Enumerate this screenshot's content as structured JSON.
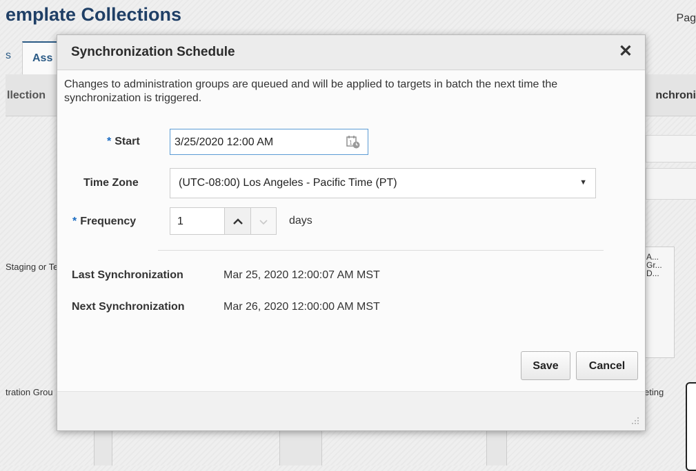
{
  "background": {
    "page_title": "emplate Collections",
    "page_link": "Pag",
    "tabs": [
      {
        "label": "s"
      },
      {
        "label": "Ass"
      }
    ],
    "section_left": "llection",
    "section_right": "nchroni",
    "node_staging": "Staging or Te",
    "node_a_lines": [
      "A...",
      "Gr...",
      "D..."
    ],
    "node_tration": "tration Grou",
    "node_eting": "eting"
  },
  "dialog": {
    "title": "Synchronization Schedule",
    "close_glyph": "✕",
    "message": "Changes to administration groups are queued and will be applied to targets in batch the next time the synchronization is triggered.",
    "required_marker": "*",
    "start": {
      "label": "Start",
      "value": "3/25/2020 12:00 AM",
      "icon": "calendar-clock-icon"
    },
    "time_zone": {
      "label": "Time Zone",
      "selected": "(UTC-08:00) Los Angeles - Pacific Time (PT)",
      "arrow_glyph": "▼"
    },
    "frequency": {
      "label": "Frequency",
      "value": "1",
      "unit": "days",
      "up_glyph": "⌃",
      "down_glyph": "⌄"
    },
    "last_sync": {
      "label": "Last Synchronization",
      "value": "Mar 25, 2020 12:00:07 AM MST"
    },
    "next_sync": {
      "label": "Next Synchronization",
      "value": "Mar 26, 2020 12:00:00 AM MST"
    },
    "save_label": "Save",
    "cancel_label": "Cancel"
  },
  "colors": {
    "title_blue": "#1f3f66",
    "required_blue": "#1b6cc2",
    "focus_border": "#5b9bd5"
  }
}
